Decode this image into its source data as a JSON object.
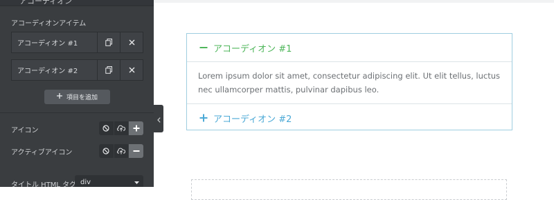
{
  "panel": {
    "top_label": "アコーディオン",
    "section_label": "アコーディオンアイテム",
    "items": [
      {
        "label": "アコーディオン #1"
      },
      {
        "label": "アコーディオン #2"
      }
    ],
    "add_button": "項目を追加",
    "icon_label": "アイコン",
    "active_icon_label": "アクティブアイコン",
    "html_tag_label": "タイトル HTML タグ",
    "html_tag_value": "div"
  },
  "accordion": {
    "items": [
      {
        "title": "アコーディオン #1",
        "state": "open",
        "content": "Lorem ipsum dolor sit amet, consectetur adipiscing elit. Ut elit tellus, luctus nec ullamcorper mattis, pulvinar dapibus leo."
      },
      {
        "title": "アコーディオン #2",
        "state": "closed"
      }
    ]
  },
  "colors": {
    "panel_bg": "#3a3d40",
    "active_title": "#4eb65a",
    "inactive_title": "#4ba9d6",
    "accordion_border": "#9ecde0"
  }
}
